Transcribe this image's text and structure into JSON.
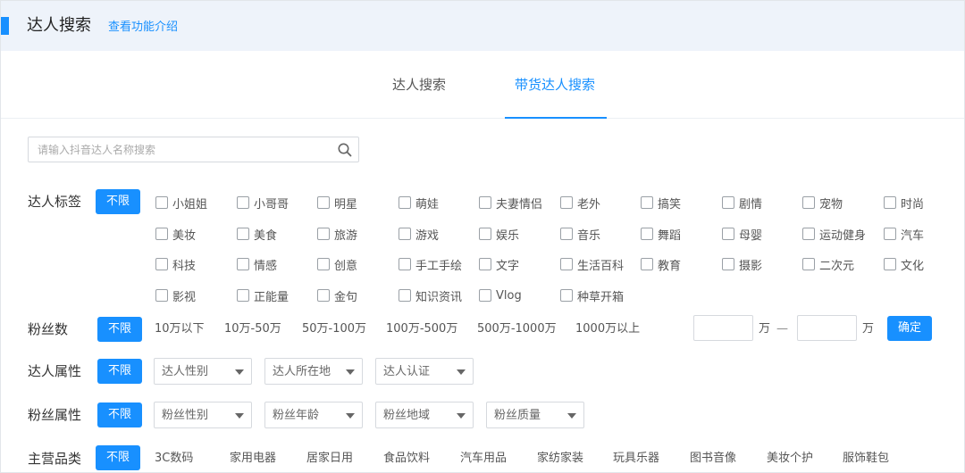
{
  "header": {
    "title": "达人搜索",
    "link": "查看功能介绍"
  },
  "tabs": [
    {
      "label": "达人搜索"
    },
    {
      "label": "带货达人搜索",
      "active": true
    }
  ],
  "search": {
    "placeholder": "请输入抖音达人名称搜索",
    "value": ""
  },
  "filters": {
    "unlimited_label": "不限",
    "tags": {
      "label": "达人标签",
      "items": [
        "小姐姐",
        "小哥哥",
        "明星",
        "萌娃",
        "夫妻情侣",
        "老外",
        "搞笑",
        "剧情",
        "宠物",
        "时尚",
        "美妆",
        "美食",
        "旅游",
        "游戏",
        "娱乐",
        "音乐",
        "舞蹈",
        "母婴",
        "运动健身",
        "汽车",
        "科技",
        "情感",
        "创意",
        "手工手绘",
        "文字",
        "生活百科",
        "教育",
        "摄影",
        "二次元",
        "文化",
        "影视",
        "正能量",
        "金句",
        "知识资讯",
        "Vlog",
        "种草开箱"
      ]
    },
    "fans": {
      "label": "粉丝数",
      "options": [
        "10万以下",
        "10万-50万",
        "50万-100万",
        "100万-500万",
        "500万-1000万",
        "1000万以上"
      ],
      "range_unit": "万",
      "range_dash": "—",
      "range_min": "",
      "range_max": "",
      "confirm_label": "确定"
    },
    "attributes": {
      "label": "达人属性",
      "dropdowns": [
        "达人性别",
        "达人所在地",
        "达人认证"
      ]
    },
    "fan_attributes": {
      "label": "粉丝属性",
      "dropdowns": [
        "粉丝性别",
        "粉丝年龄",
        "粉丝地域",
        "粉丝质量"
      ]
    },
    "category": {
      "label": "主营品类",
      "options": [
        "3C数码",
        "家用电器",
        "居家日用",
        "食品饮料",
        "汽车用品",
        "家纺家装",
        "玩具乐器",
        "图书音像",
        "美妆个护",
        "服饰鞋包"
      ]
    }
  },
  "colors": {
    "accent": "#1890ff",
    "header_bg": "#eef3fa"
  }
}
